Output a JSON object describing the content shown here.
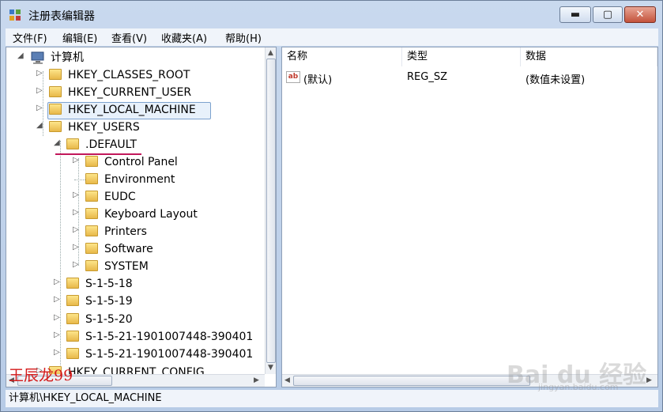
{
  "window": {
    "title": "注册表编辑器",
    "min_label": "▬",
    "max_label": "▢",
    "close_label": "✕"
  },
  "menu": [
    "文件(F)",
    "编辑(E)",
    "查看(V)",
    "收藏夹(A)",
    "帮助(H)"
  ],
  "tree": {
    "root": "计算机",
    "items": [
      {
        "label": "HKEY_CLASSES_ROOT",
        "expanded": false
      },
      {
        "label": "HKEY_CURRENT_USER",
        "expanded": false
      },
      {
        "label": "HKEY_LOCAL_MACHINE",
        "expanded": false,
        "selected": true
      },
      {
        "label": "HKEY_USERS",
        "expanded": true
      },
      {
        "label": ".DEFAULT",
        "expanded": true
      },
      {
        "label": "Control Panel",
        "expanded": false
      },
      {
        "label": "Environment",
        "expanded": false
      },
      {
        "label": "EUDC",
        "expanded": false
      },
      {
        "label": "Keyboard Layout",
        "expanded": false
      },
      {
        "label": "Printers",
        "expanded": false
      },
      {
        "label": "Software",
        "expanded": false
      },
      {
        "label": "SYSTEM",
        "expanded": false
      },
      {
        "label": "S-1-5-18",
        "expanded": false
      },
      {
        "label": "S-1-5-19",
        "expanded": false
      },
      {
        "label": "S-1-5-20",
        "expanded": false
      },
      {
        "label": "S-1-5-21-1901007448-390401",
        "expanded": false
      },
      {
        "label": "S-1-5-21-1901007448-390401",
        "expanded": false
      },
      {
        "label": "HKEY_CURRENT_CONFIG",
        "expanded": false
      }
    ]
  },
  "list": {
    "columns": [
      "名称",
      "类型",
      "数据"
    ],
    "rows": [
      {
        "name": "(默认)",
        "type": "REG_SZ",
        "data": "(数值未设置)"
      }
    ]
  },
  "status": "计算机\\HKEY_LOCAL_MACHINE",
  "watermarks": {
    "author": "王辰龙99",
    "brand": "Bai du 经验",
    "url": "jingyan.baidu.com"
  },
  "colors": {
    "accent_underline": "#c2185b",
    "selection_border": "#7da2ce"
  }
}
